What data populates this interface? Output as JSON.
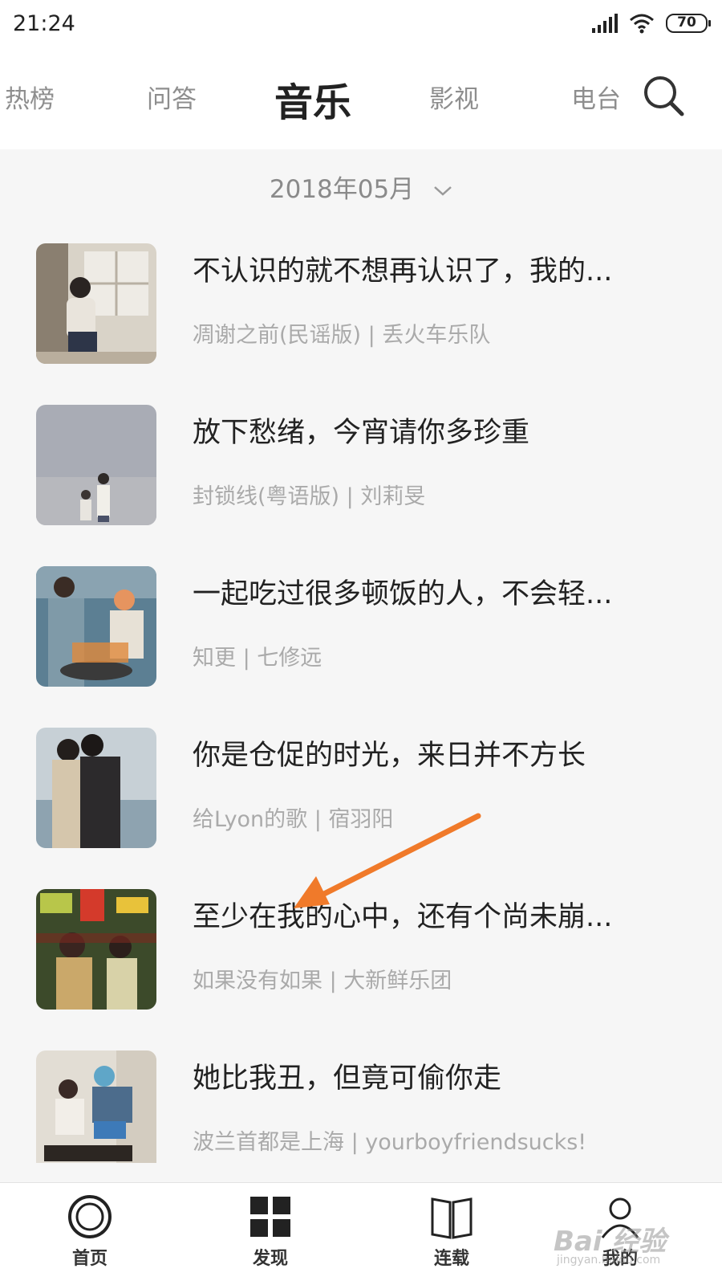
{
  "status_bar": {
    "time": "21:24",
    "battery": "70",
    "icons": [
      "signal-icon",
      "wifi-icon",
      "battery-icon"
    ]
  },
  "top_nav": {
    "tabs": [
      {
        "label": "热榜",
        "active": false
      },
      {
        "label": "问答",
        "active": false
      },
      {
        "label": "音乐",
        "active": true
      },
      {
        "label": "影视",
        "active": false
      },
      {
        "label": "电台",
        "active": false
      }
    ],
    "search_icon": "search-icon"
  },
  "month_picker": {
    "label": "2018年05月",
    "icon": "chevron-down-icon"
  },
  "items": [
    {
      "title": "不认识的就不想再认识了，我的...",
      "subtitle": "凋谢之前(民谣版) | 丢火车乐队"
    },
    {
      "title": "放下愁绪，今宵请你多珍重",
      "subtitle": "封锁线(粤语版) | 刘莉旻"
    },
    {
      "title": "一起吃过很多顿饭的人，不会轻...",
      "subtitle": "知更 | 七修远"
    },
    {
      "title": "你是仓促的时光，来日并不方长",
      "subtitle": "给Lyon的歌 | 宿羽阳"
    },
    {
      "title": "至少在我的心中，还有个尚未崩...",
      "subtitle": "如果没有如果 | 大新鲜乐团"
    },
    {
      "title": "她比我丑，但竟可偷你走",
      "subtitle": "波兰首都是上海 | yourboyfriendsucks!"
    }
  ],
  "annotation": {
    "color": "#f07a2a"
  },
  "bottom_nav": {
    "items": [
      {
        "label": "首页",
        "icon": "home-icon"
      },
      {
        "label": "发现",
        "icon": "discover-icon"
      },
      {
        "label": "连载",
        "icon": "book-icon"
      },
      {
        "label": "我的",
        "icon": "profile-icon"
      }
    ]
  },
  "watermark": {
    "text": "Bai 经验",
    "sub": "jingyan.baidu.com"
  }
}
